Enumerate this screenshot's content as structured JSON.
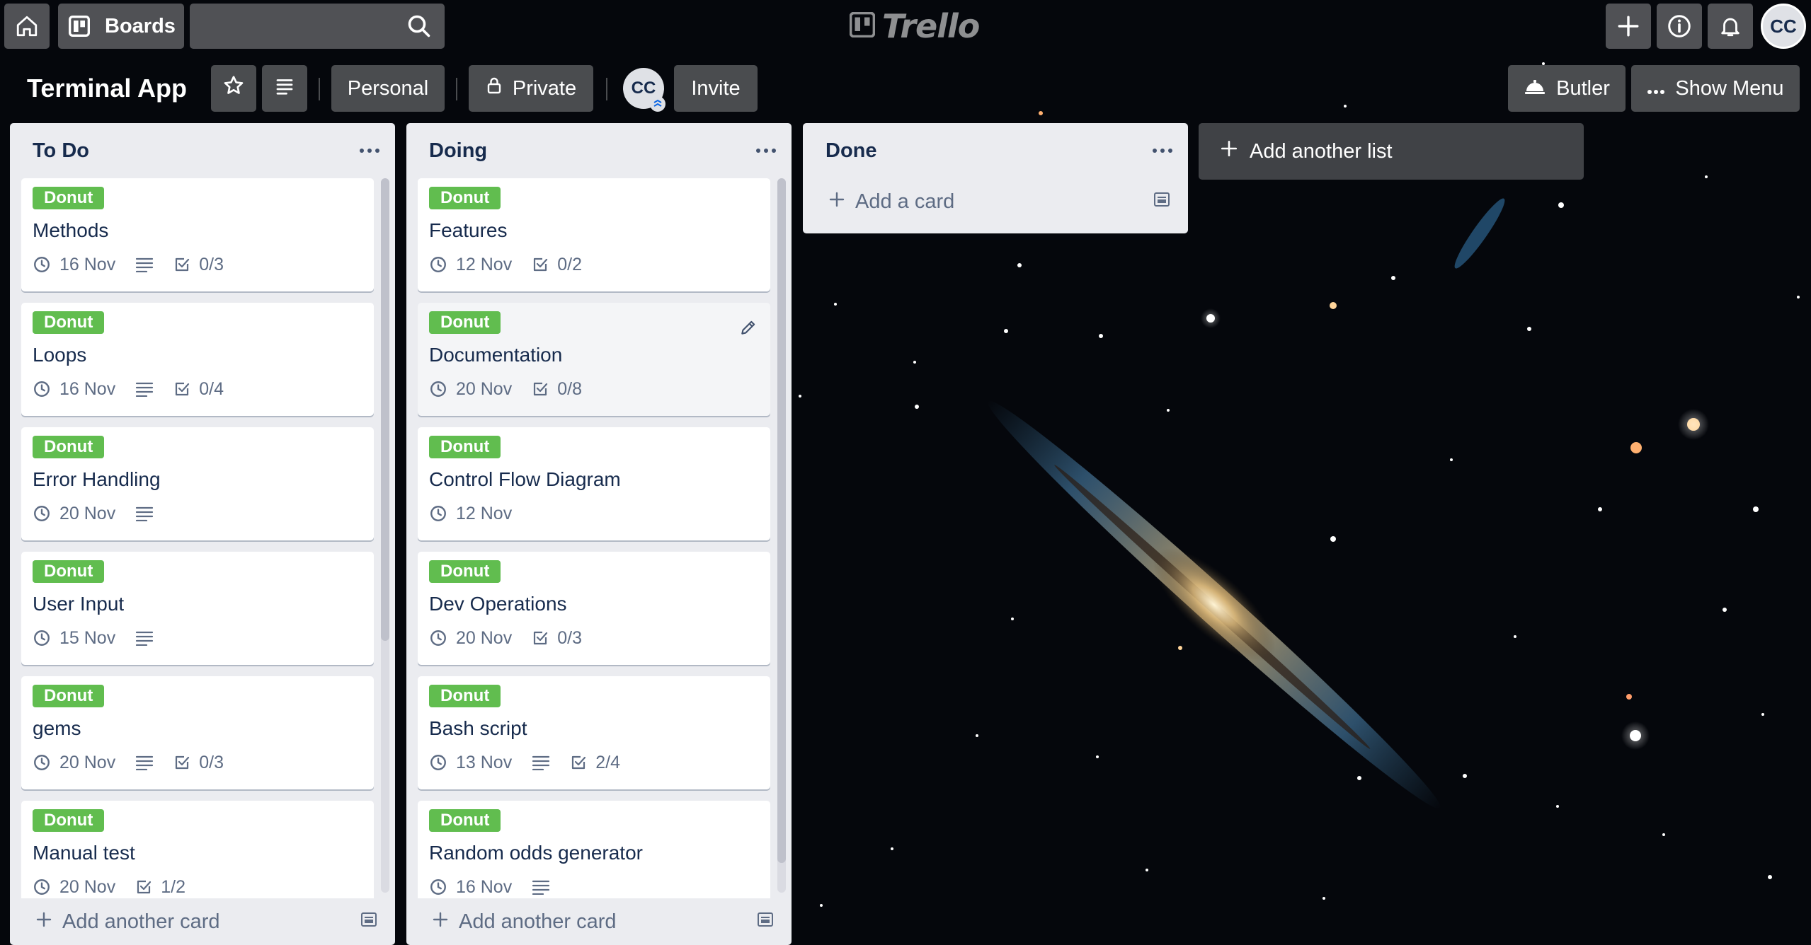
{
  "header": {
    "boards_label": "Boards",
    "search": {
      "value": "",
      "placeholder": ""
    },
    "logo_text": "Trello",
    "avatar_initials": "CC"
  },
  "board": {
    "title": "Terminal App",
    "visibility_team": "Personal",
    "visibility": "Private",
    "member_initials": "CC",
    "invite_label": "Invite",
    "butler_label": "Butler",
    "show_menu_label": "Show Menu"
  },
  "lists": [
    {
      "title": "To Do",
      "add_card_label": "Add another card",
      "cards": [
        {
          "label": "Donut",
          "title": "Methods",
          "due": "16 Nov",
          "has_description": true,
          "checklist": "0/3"
        },
        {
          "label": "Donut",
          "title": "Loops",
          "due": "16 Nov",
          "has_description": true,
          "checklist": "0/4"
        },
        {
          "label": "Donut",
          "title": "Error Handling",
          "due": "20 Nov",
          "has_description": true,
          "checklist": ""
        },
        {
          "label": "Donut",
          "title": "User Input",
          "due": "15 Nov",
          "has_description": true,
          "checklist": ""
        },
        {
          "label": "Donut",
          "title": "gems",
          "due": "20 Nov",
          "has_description": true,
          "checklist": "0/3"
        },
        {
          "label": "Donut",
          "title": "Manual test",
          "due": "20 Nov",
          "has_description": false,
          "checklist": "1/2"
        }
      ]
    },
    {
      "title": "Doing",
      "add_card_label": "Add another card",
      "cards": [
        {
          "label": "Donut",
          "title": "Features",
          "due": "12 Nov",
          "has_description": false,
          "checklist": "0/2"
        },
        {
          "label": "Donut",
          "title": "Documentation",
          "due": "20 Nov",
          "has_description": false,
          "checklist": "0/8"
        },
        {
          "label": "Donut",
          "title": "Control Flow Diagram",
          "due": "12 Nov",
          "has_description": false,
          "checklist": ""
        },
        {
          "label": "Donut",
          "title": "Dev Operations",
          "due": "20 Nov",
          "has_description": false,
          "checklist": "0/3"
        },
        {
          "label": "Donut",
          "title": "Bash script",
          "due": "13 Nov",
          "has_description": true,
          "checklist": "2/4"
        },
        {
          "label": "Donut",
          "title": "Random odds generator",
          "due": "16 Nov",
          "has_description": true,
          "checklist": ""
        }
      ]
    },
    {
      "title": "Done",
      "add_card_label": "Add a card",
      "cards": []
    }
  ],
  "add_list_label": "Add another list",
  "colors": {
    "label_green": "#61bd4f",
    "list_bg": "#ebecf0",
    "text_dark": "#172b4d",
    "text_muted": "#5e6c84"
  }
}
